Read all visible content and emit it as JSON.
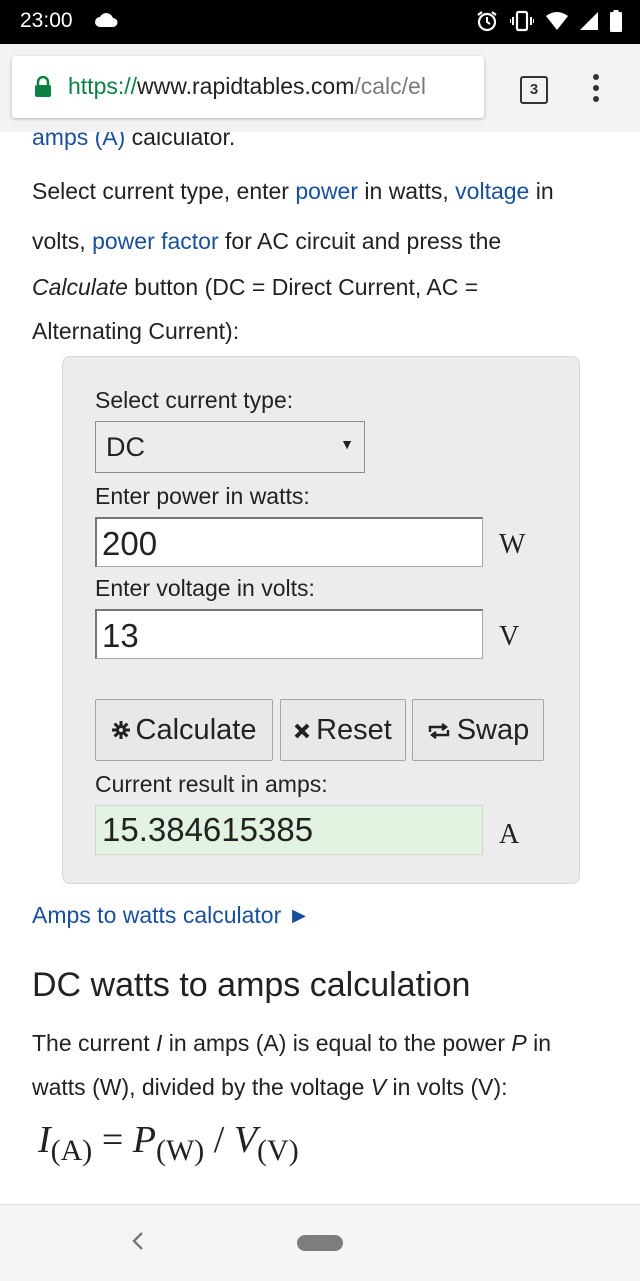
{
  "status_bar": {
    "time": "23:00"
  },
  "browser": {
    "url_scheme": "https://",
    "url_host": "www.rapidtables.com",
    "url_path": "/calc/el",
    "tab_count": "3"
  },
  "intro": {
    "line0_link": "amps (A)",
    "line0_text": " calculator.",
    "line1_text_a": "Select current type, enter ",
    "line1_link_a": "power",
    "line1_text_b": " in watts, ",
    "line1_link_b": "voltage",
    "line1_text_c": " in",
    "line2_text_a": "volts, ",
    "line2_link": "power factor",
    "line2_text_b": " for AC circuit and press the",
    "line3_italic": "Calculate",
    "line3_text": " button (DC = Direct Current, AC =",
    "line4_text": "Alternating Current):"
  },
  "calculator": {
    "current_type_label": "Select current type:",
    "current_type_value": "DC",
    "power_label": "Enter power in watts:",
    "power_value": "200",
    "power_unit": "W",
    "voltage_label": "Enter voltage in volts:",
    "voltage_value": "13",
    "voltage_unit": "V",
    "calculate_label": "Calculate",
    "reset_label": "Reset",
    "swap_label": "Swap",
    "result_label": "Current result in amps:",
    "result_value": "15.384615385",
    "result_unit": "A"
  },
  "links": {
    "amps_to_watts": "Amps to watts calculator ►"
  },
  "section": {
    "heading": "DC watts to amps calculation",
    "desc1_a": "The current ",
    "desc1_i": "I",
    "desc1_b": " in amps (A) is equal to the power ",
    "desc1_p": "P",
    "desc1_c": " in",
    "desc2_a": "watts (W), divided by the voltage ",
    "desc2_v": "V",
    "desc2_b": " in volts (V):",
    "formula_I": "I",
    "formula_I_sub": "(A)",
    "formula_eq": " = ",
    "formula_P": "P",
    "formula_P_sub": "(W)",
    "formula_div": " / ",
    "formula_V": "V",
    "formula_V_sub": "(V)"
  },
  "icons": {
    "cloud": "cloud-icon",
    "alarm": "alarm-icon",
    "vibrate": "vibrate-icon",
    "wifi": "wifi-icon",
    "signal": "signal-icon",
    "battery": "battery-icon",
    "lock": "lock-icon",
    "gear": "gear-icon",
    "close": "close-icon",
    "swap": "swap-icon",
    "back": "back-icon",
    "home": "home-icon"
  },
  "colors": {
    "link": "#1a4f9c",
    "secure": "#0b8043",
    "result_bg": "#e3f3e1",
    "panel_bg": "#ececec"
  }
}
